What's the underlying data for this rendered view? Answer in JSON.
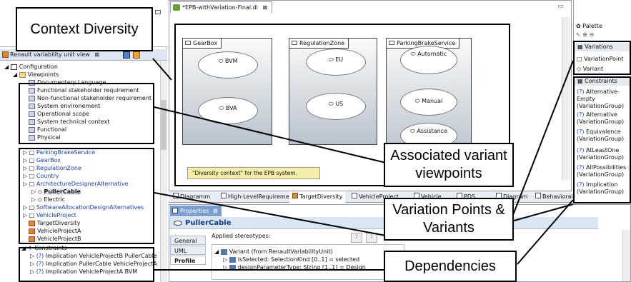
{
  "editor": {
    "tab_title": "*EPB-withVariation-Final.di",
    "packages": [
      {
        "name": "GearBox",
        "elements": [
          "BVM",
          "BVA"
        ]
      },
      {
        "name": "RegulationZone",
        "elements": [
          "EU",
          "US"
        ]
      },
      {
        "name": "ParkingBrakeService",
        "elements": [
          "Automatic",
          "Manual",
          "Assistance"
        ]
      }
    ],
    "note": "\"Diversity context\" for the EPB system.",
    "bottom_tabs": [
      "Diagramm",
      "High-LevelRequirement",
      "TargetDiversity",
      "VehicleProject",
      "Vehicle",
      "PDS",
      "Diagram",
      "Behavioral technical requirement"
    ]
  },
  "variability_view": {
    "title": "Renault variability unit view",
    "root": "Configuration",
    "viewpoints_label": "Viewpoints",
    "viewpoints": [
      "Documentary Language",
      "Functional stakeholder requirement",
      "Non-functional stakeholder requirement",
      "System environement",
      "Operational scope",
      "System technical context",
      "Functional",
      "Physical"
    ],
    "variation_items": [
      "ParkingBrakeService",
      "GearBox",
      "RegulationZone",
      "Country",
      "ArchitectureDesignerAlternative"
    ],
    "variants": [
      "PullerCable",
      "Electric"
    ],
    "more_items": [
      "SoftwareAllocationDesignAlternatives",
      "VehicleProject",
      "TargetDiversity",
      "VehicleProjectA",
      "VehicleProjectB"
    ],
    "constraints_label": "Constraints",
    "constraints": [
      "Implication VehicleProjectB PullerCable",
      "Implication PullerCable VehicleProjectA",
      "Implication VehicleProjectA BVM"
    ]
  },
  "properties": {
    "tab": "Properties",
    "element": "PullerCable",
    "side_tabs": [
      "General",
      "UML",
      "Profile"
    ],
    "applied_label": "Applied stereotypes:",
    "rows": [
      "Variant  (from RenaultVariabilityUnit)",
      "isSelected: SelectionKind [0..1] = selected",
      "designParameterType: String [1..1] = Design"
    ]
  },
  "palette": {
    "title": "Palette",
    "variations_label": "Variations",
    "variations": [
      "VariationPoint",
      "Variant"
    ],
    "constraints_label": "Constraints",
    "constraints": [
      "Alternative-Empty (VariationGroup)",
      "Alternative (VariationGroup)",
      "Equivalence (VariationGroup)",
      "AtLeastOne (VariationGroup)",
      "AllPossibilities (VariationGroup)",
      "Implication (VariationGroup)"
    ]
  },
  "annotations": {
    "context": "Context Diversity",
    "viewpoints": "Associated variant viewpoints",
    "variation": "Variation Points & Variants",
    "dependencies": "Dependencies"
  }
}
